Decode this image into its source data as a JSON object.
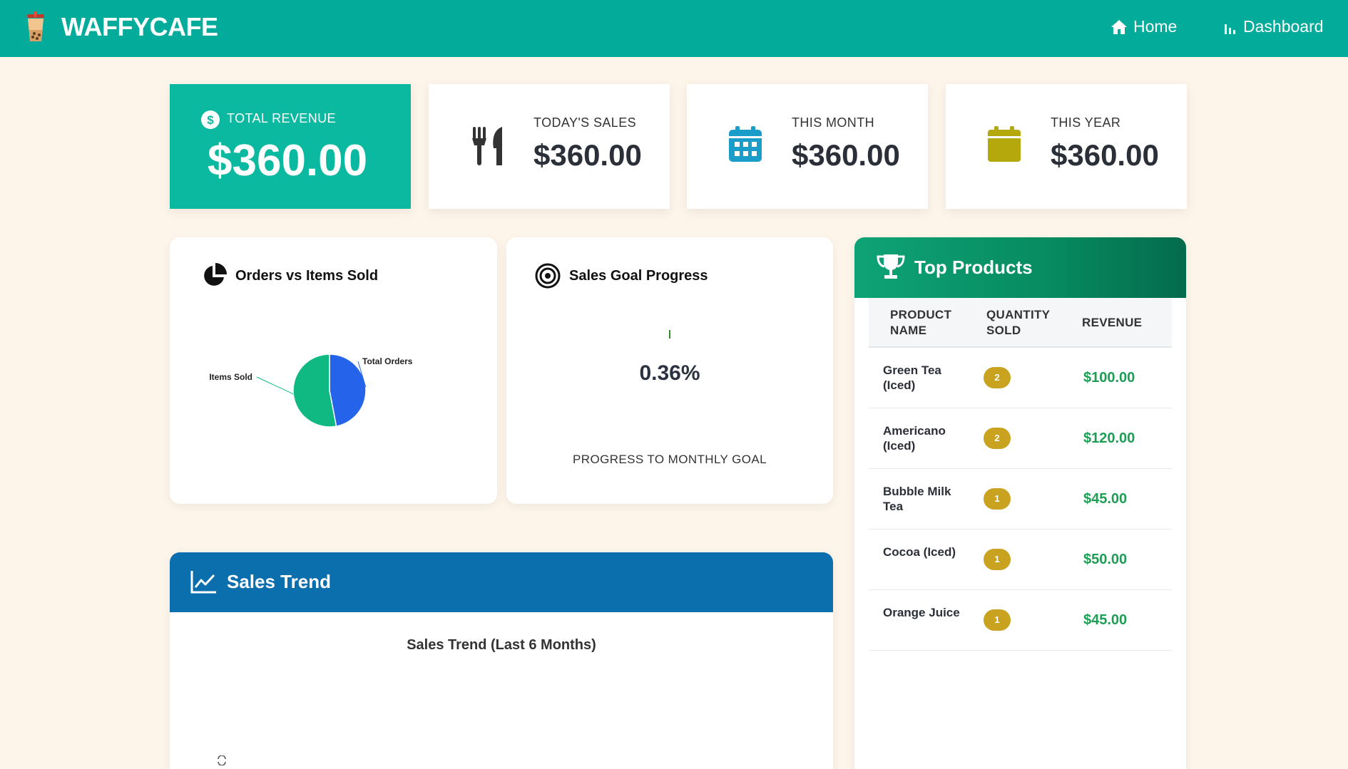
{
  "navbar": {
    "brand": "WAFFYCAFE",
    "links": [
      {
        "label": "Home",
        "icon": "home-icon"
      },
      {
        "label": "Dashboard",
        "icon": "bar-chart-icon"
      }
    ]
  },
  "stats": {
    "total_revenue": {
      "label": "TOTAL REVENUE",
      "value": "$360.00",
      "icon": "dollar-circle-icon"
    },
    "today": {
      "label": "TODAY'S SALES",
      "value": "$360.00",
      "icon": "utensils-icon"
    },
    "month": {
      "label": "THIS MONTH",
      "value": "$360.00",
      "icon": "calendar-days-icon"
    },
    "year": {
      "label": "THIS YEAR",
      "value": "$360.00",
      "icon": "calendar-icon"
    }
  },
  "orders_chart": {
    "title": "Orders vs Items Sold",
    "chart_data": {
      "type": "pie",
      "labels": [
        "Total Orders",
        "Items Sold"
      ],
      "values": [
        47,
        53
      ],
      "colors": [
        "#2563eb",
        "#10b981"
      ]
    }
  },
  "goal": {
    "title": "Sales Goal Progress",
    "value": "0.36%",
    "progress": 0.0036,
    "caption": "PROGRESS TO MONTHLY GOAL"
  },
  "trend": {
    "header": "Sales Trend",
    "chart_title": "Sales Trend (Last 6 Months)"
  },
  "top_products": {
    "title": "Top Products",
    "columns": {
      "name": "PRODUCT NAME",
      "qty": "QUANTITY SOLD",
      "revenue": "REVENUE"
    },
    "rows": [
      {
        "name": "Green Tea (Iced)",
        "qty": "2",
        "revenue": "$100.00"
      },
      {
        "name": "Americano (Iced)",
        "qty": "2",
        "revenue": "$120.00"
      },
      {
        "name": "Bubble Milk Tea",
        "qty": "1",
        "revenue": "$45.00"
      },
      {
        "name": "Cocoa (Iced)",
        "qty": "1",
        "revenue": "$50.00"
      },
      {
        "name": "Orange Juice",
        "qty": "1",
        "revenue": "$45.00"
      }
    ]
  },
  "colors": {
    "navbar": "#02ab9a",
    "primary_card": "#0bb8a0",
    "trend_header": "#0b6ead",
    "top_header": "#078a5f",
    "badge": "#c9a21f",
    "revenue": "#1e9e55",
    "background": "#fdf5e9"
  }
}
